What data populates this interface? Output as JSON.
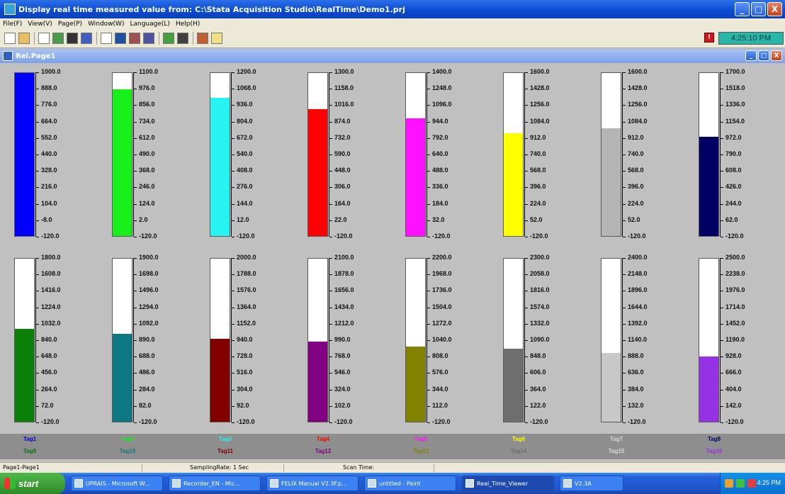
{
  "window": {
    "title": "Display real time measured value from: C:\\Stata Acquisition Studio\\RealTime\\Demo1.prj",
    "min_label": "_",
    "max_label": "□",
    "close_label": "X"
  },
  "menu": [
    "File(F)",
    "View(V)",
    "Page(P)",
    "Window(W)",
    "Language(L)",
    "Help(H)"
  ],
  "toolbar": {
    "alarm_label": "!",
    "clock": "4:25:10 PM",
    "buttons": [
      "new-icon",
      "open-icon",
      "doc-icon",
      "gear-icon",
      "stop-icon",
      "grid-icon",
      "page-icon",
      "chart-icon",
      "bars-icon",
      "bars2-icon",
      "table-icon",
      "list-icon",
      "settings-icon",
      "warning-icon"
    ]
  },
  "child_window": {
    "title": "Rel.Page1"
  },
  "gauges": [
    {
      "max": 1000,
      "color": "#0000ff",
      "labels": [
        "1000.0",
        "888.0",
        "776.0",
        "664.0",
        "552.0",
        "440.0",
        "328.0",
        "216.0",
        "104.0",
        "-8.0",
        "-120.0"
      ],
      "level": 1.0
    },
    {
      "max": 1100,
      "color": "#19f019",
      "labels": [
        "1100.0",
        "976.0",
        "856.0",
        "734.0",
        "612.0",
        "490.0",
        "368.0",
        "246.0",
        "124.0",
        "2.0",
        "-120.0"
      ],
      "level": 0.9
    },
    {
      "max": 1200,
      "color": "#28f3f3",
      "labels": [
        "1200.0",
        "1068.0",
        "936.0",
        "804.0",
        "672.0",
        "540.0",
        "408.0",
        "276.0",
        "144.0",
        "12.0",
        "-120.0"
      ],
      "level": 0.85
    },
    {
      "max": 1300,
      "color": "#ff0000",
      "labels": [
        "1300.0",
        "1158.0",
        "1016.0",
        "874.0",
        "732.0",
        "590.0",
        "448.0",
        "306.0",
        "164.0",
        "22.0",
        "-120.0"
      ],
      "level": 0.78
    },
    {
      "max": 1400,
      "color": "#ff10ff",
      "labels": [
        "1400.0",
        "1248.0",
        "1096.0",
        "944.0",
        "792.0",
        "640.0",
        "488.0",
        "336.0",
        "184.0",
        "32.0",
        "-120.0"
      ],
      "level": 0.72
    },
    {
      "max": 1600,
      "color": "#ffff00",
      "labels": [
        "1600.0",
        "1428.0",
        "1256.0",
        "1084.0",
        "912.0",
        "740.0",
        "568.0",
        "396.0",
        "224.0",
        "52.0",
        "-120.0"
      ],
      "level": 0.63
    },
    {
      "max": 1600,
      "color": "#b4b4b4",
      "labels": [
        "1600.0",
        "1428.0",
        "1256.0",
        "1084.0",
        "912.0",
        "740.0",
        "568.0",
        "396.0",
        "224.0",
        "52.0",
        "-120.0"
      ],
      "level": 0.66
    },
    {
      "max": 1700,
      "color": "#000064",
      "labels": [
        "1700.0",
        "1518.0",
        "1336.0",
        "1154.0",
        "972.0",
        "790.0",
        "608.0",
        "426.0",
        "244.0",
        "62.0",
        "-120.0"
      ],
      "level": 0.61
    },
    {
      "max": 1800,
      "color": "#0a800a",
      "labels": [
        "1800.0",
        "1608.0",
        "1416.0",
        "1224.0",
        "1032.0",
        "840.0",
        "648.0",
        "456.0",
        "264.0",
        "72.0",
        "-120.0"
      ],
      "level": 0.57
    },
    {
      "max": 1900,
      "color": "#0e7882",
      "labels": [
        "1900.0",
        "1698.0",
        "1496.0",
        "1294.0",
        "1092.0",
        "890.0",
        "688.0",
        "486.0",
        "284.0",
        "82.0",
        "-120.0"
      ],
      "level": 0.54
    },
    {
      "max": 2000,
      "color": "#820000",
      "labels": [
        "2000.0",
        "1788.0",
        "1576.0",
        "1364.0",
        "1152.0",
        "940.0",
        "728.0",
        "516.0",
        "304.0",
        "92.0",
        "-120.0"
      ],
      "level": 0.51
    },
    {
      "max": 2100,
      "color": "#820082",
      "labels": [
        "2100.0",
        "1878.0",
        "1656.0",
        "1434.0",
        "1212.0",
        "990.0",
        "768.0",
        "546.0",
        "324.0",
        "102.0",
        "-120.0"
      ],
      "level": 0.49
    },
    {
      "max": 2200,
      "color": "#828200",
      "labels": [
        "2200.0",
        "1968.0",
        "1736.0",
        "1504.0",
        "1272.0",
        "1040.0",
        "808.0",
        "576.0",
        "344.0",
        "112.0",
        "-120.0"
      ],
      "level": 0.46
    },
    {
      "max": 2300,
      "color": "#6e6e6e",
      "labels": [
        "2300.0",
        "2058.0",
        "1816.0",
        "1574.0",
        "1332.0",
        "1090.0",
        "848.0",
        "606.0",
        "364.0",
        "122.0",
        "-120.0"
      ],
      "level": 0.45
    },
    {
      "max": 2400,
      "color": "#c8c8c8",
      "labels": [
        "2400.0",
        "2148.0",
        "1896.0",
        "1644.0",
        "1392.0",
        "1140.0",
        "888.0",
        "636.0",
        "384.0",
        "132.0",
        "-120.0"
      ],
      "level": 0.42
    },
    {
      "max": 2500,
      "color": "#9632e6",
      "labels": [
        "2500.0",
        "2238.0",
        "1976.0",
        "1714.0",
        "1452.0",
        "1190.0",
        "928.0",
        "666.0",
        "404.0",
        "142.0",
        "-120.0"
      ],
      "level": 0.4
    }
  ],
  "legend": [
    {
      "label": "Tag1",
      "color": "#0000c8"
    },
    {
      "label": "Tag2",
      "color": "#19f019"
    },
    {
      "label": "Tag3",
      "color": "#28f3f3"
    },
    {
      "label": "Tag4",
      "color": "#ff0000"
    },
    {
      "label": "Tag5",
      "color": "#ff10ff"
    },
    {
      "label": "Tag6",
      "color": "#ffff00"
    },
    {
      "label": "Tag7",
      "color": "#d8d8d8"
    },
    {
      "label": "Tag8",
      "color": "#000064"
    },
    {
      "label": "Tag9",
      "color": "#0a6e0a"
    },
    {
      "label": "Tag10",
      "color": "#0e7882"
    },
    {
      "label": "Tag11",
      "color": "#820000"
    },
    {
      "label": "Tag12",
      "color": "#820082"
    },
    {
      "label": "Tag13",
      "color": "#828200"
    },
    {
      "label": "Tag14",
      "color": "#6e6e6e"
    },
    {
      "label": "Tag15",
      "color": "#d8d8d8"
    },
    {
      "label": "Tag16",
      "color": "#9632e6"
    }
  ],
  "status": {
    "page": "Page1-Page1",
    "sampling": "SamplingRate: 1 Sec",
    "scan": "Scan Time:"
  },
  "taskbar": {
    "start": "start",
    "tasks": [
      "UPRAIS - Microsoft W...",
      "Recorder_EN - Mic...",
      "FELIX Manual V2.3F.p...",
      "untitled - Paint",
      "Real_Time_Viewer",
      "V2.3A"
    ],
    "time": "4:25 PM"
  }
}
